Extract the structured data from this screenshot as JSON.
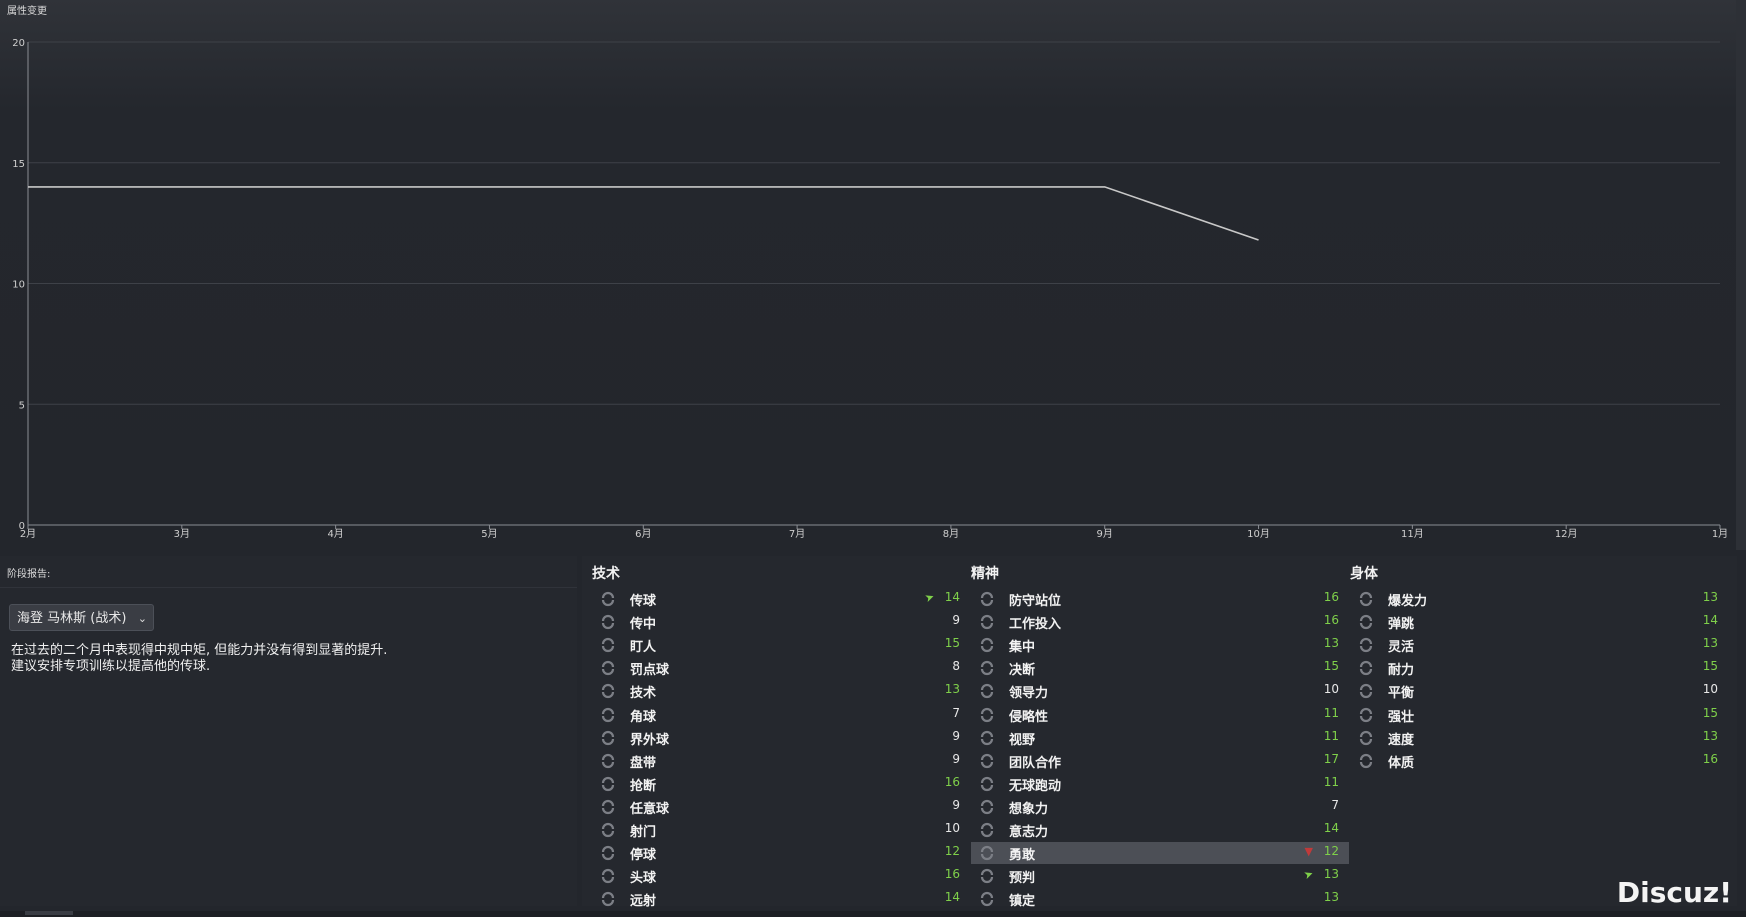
{
  "panel_title": "属性变更",
  "chart_data": {
    "type": "line",
    "ylim": [
      0,
      20
    ],
    "y_ticks": [
      "0",
      "5",
      "10",
      "15",
      "20"
    ],
    "x_ticks": [
      "2月",
      "3月",
      "4月",
      "5月",
      "6月",
      "7月",
      "8月",
      "9月",
      "10月",
      "11月",
      "12月",
      "1月"
    ],
    "series": [
      {
        "x": [
          "2月",
          "3月",
          "4月",
          "5月",
          "6月",
          "7月",
          "8月",
          "9月",
          "10月"
        ],
        "values": [
          14,
          14,
          14,
          14,
          14,
          14,
          14,
          14,
          11.8
        ]
      }
    ],
    "grid": true,
    "line_color": "#c8c8c8"
  },
  "report": {
    "title": "阶段报告:",
    "dropdown_value": "海登 马林斯 (战术)",
    "text_lines": [
      "在过去的二个月中表现得中规中矩, 但能力并没有得到显著的提升.",
      "建议安排专项训练以提高他的传球."
    ]
  },
  "attributes": {
    "technical": {
      "title": "技术",
      "items": [
        {
          "name": "传球",
          "value": "14",
          "trend": "up",
          "color": "green"
        },
        {
          "name": "传中",
          "value": "9",
          "color": "white"
        },
        {
          "name": "盯人",
          "value": "15",
          "color": "green"
        },
        {
          "name": "罚点球",
          "value": "8",
          "color": "white"
        },
        {
          "name": "技术",
          "value": "13",
          "color": "green"
        },
        {
          "name": "角球",
          "value": "7",
          "color": "white"
        },
        {
          "name": "界外球",
          "value": "9",
          "color": "white"
        },
        {
          "name": "盘带",
          "value": "9",
          "color": "white"
        },
        {
          "name": "抢断",
          "value": "16",
          "color": "green"
        },
        {
          "name": "任意球",
          "value": "9",
          "color": "white"
        },
        {
          "name": "射门",
          "value": "10",
          "color": "white"
        },
        {
          "name": "停球",
          "value": "12",
          "color": "green"
        },
        {
          "name": "头球",
          "value": "16",
          "color": "green"
        },
        {
          "name": "远射",
          "value": "14",
          "color": "green"
        }
      ]
    },
    "mental": {
      "title": "精神",
      "items": [
        {
          "name": "防守站位",
          "value": "16",
          "color": "green"
        },
        {
          "name": "工作投入",
          "value": "16",
          "color": "green"
        },
        {
          "name": "集中",
          "value": "13",
          "color": "green"
        },
        {
          "name": "决断",
          "value": "15",
          "color": "green"
        },
        {
          "name": "领导力",
          "value": "10",
          "color": "white"
        },
        {
          "name": "侵略性",
          "value": "11",
          "color": "green"
        },
        {
          "name": "视野",
          "value": "11",
          "color": "green"
        },
        {
          "name": "团队合作",
          "value": "17",
          "color": "green"
        },
        {
          "name": "无球跑动",
          "value": "11",
          "color": "green"
        },
        {
          "name": "想象力",
          "value": "7",
          "color": "white"
        },
        {
          "name": "意志力",
          "value": "14",
          "color": "green"
        },
        {
          "name": "勇敢",
          "value": "12",
          "trend": "down",
          "color": "green",
          "highlight": true
        },
        {
          "name": "预判",
          "value": "13",
          "trend": "up",
          "color": "green"
        },
        {
          "name": "镇定",
          "value": "13",
          "color": "green"
        }
      ]
    },
    "physical": {
      "title": "身体",
      "items": [
        {
          "name": "爆发力",
          "value": "13",
          "color": "green"
        },
        {
          "name": "弹跳",
          "value": "14",
          "color": "green"
        },
        {
          "name": "灵活",
          "value": "13",
          "color": "green"
        },
        {
          "name": "耐力",
          "value": "15",
          "color": "green"
        },
        {
          "name": "平衡",
          "value": "10",
          "color": "white"
        },
        {
          "name": "强壮",
          "value": "15",
          "color": "green"
        },
        {
          "name": "速度",
          "value": "13",
          "color": "green"
        },
        {
          "name": "体质",
          "value": "16",
          "color": "green"
        }
      ]
    }
  },
  "watermark": "Discuz!"
}
